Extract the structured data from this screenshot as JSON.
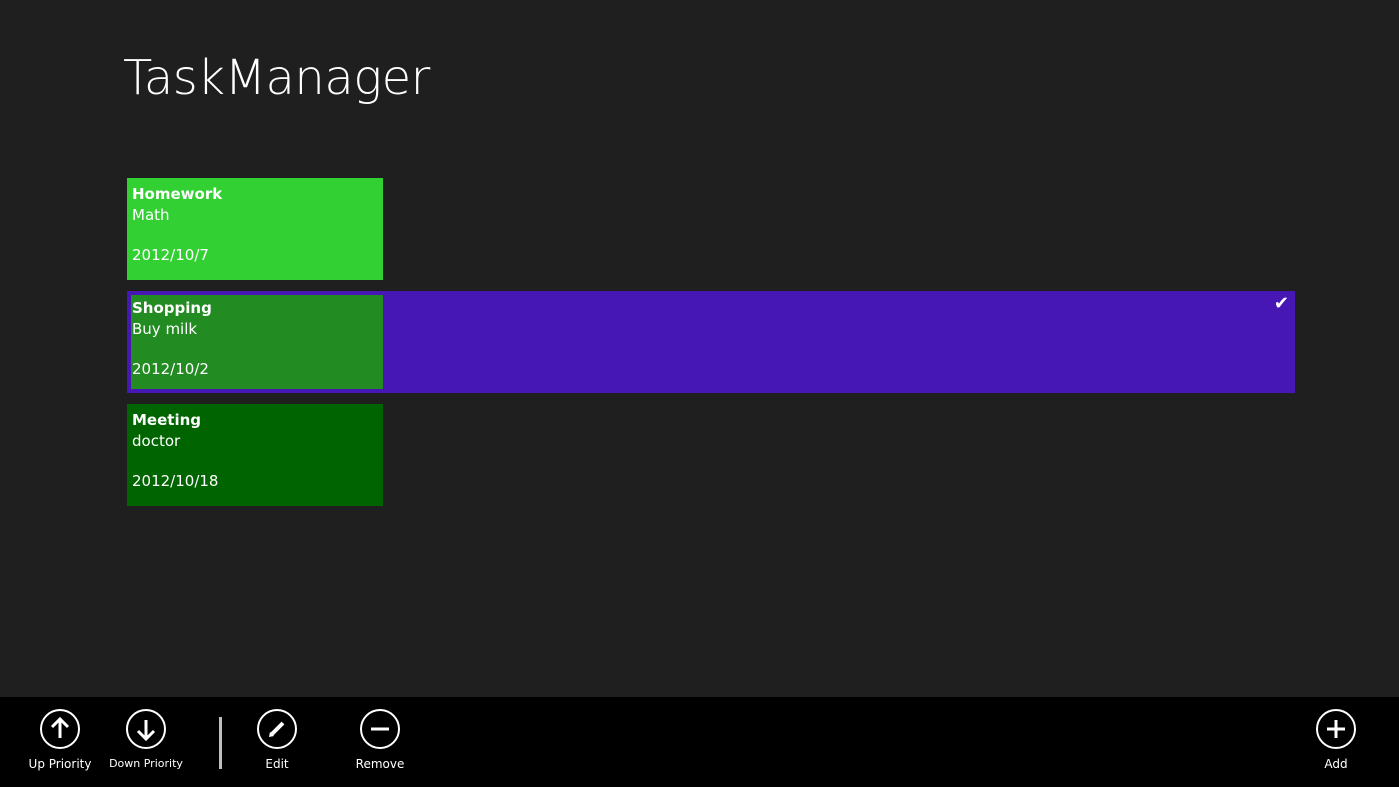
{
  "app": {
    "title": "TaskManager"
  },
  "tasks": [
    {
      "title": "Homework",
      "description": "Math",
      "date": "2012/10/7",
      "color": "#33d033",
      "selected": false
    },
    {
      "title": "Shopping",
      "description": "Buy milk",
      "date": "2012/10/2",
      "color": "#228b22",
      "selected": true
    },
    {
      "title": "Meeting",
      "description": "doctor",
      "date": "2012/10/18",
      "color": "#006400",
      "selected": false
    }
  ],
  "selection": {
    "color": "#4617b4",
    "check_icon": "checkmark-icon"
  },
  "app_bar": {
    "up_priority": {
      "label": "Up Priority",
      "icon": "arrow-up-circle-icon"
    },
    "down_priority": {
      "label": "Down Priority",
      "icon": "arrow-down-circle-icon"
    },
    "edit": {
      "label": "Edit",
      "icon": "pencil-circle-icon"
    },
    "remove": {
      "label": "Remove",
      "icon": "minus-circle-icon"
    },
    "add": {
      "label": "Add",
      "icon": "plus-circle-icon"
    }
  }
}
